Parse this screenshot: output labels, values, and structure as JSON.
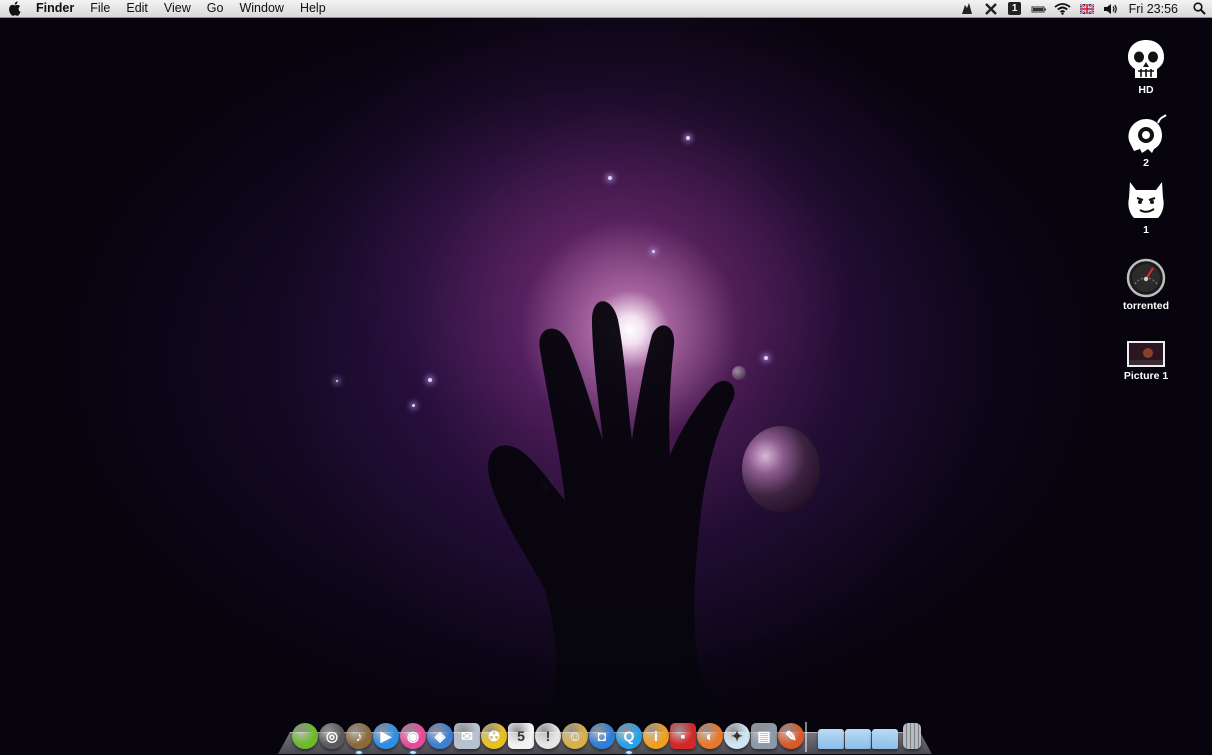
{
  "menubar": {
    "apple_icon": "apple-logo-icon",
    "items": [
      "Finder",
      "File",
      "Edit",
      "View",
      "Go",
      "Window",
      "Help"
    ],
    "status_icons": [
      "growl-icon",
      "tools-icon",
      "number-badge-icon",
      "battery-icon",
      "wifi-icon",
      "flag-uk-icon",
      "volume-icon"
    ],
    "status_badge_text": "1",
    "clock": "Fri 23:56",
    "spotlight_icon": "spotlight-search-icon"
  },
  "desktop": {
    "icons": [
      {
        "label": "HD",
        "icon": "skull-drive-icon"
      },
      {
        "label": "2",
        "icon": "monster-drive-icon"
      },
      {
        "label": "1",
        "icon": "cat-drive-icon"
      },
      {
        "label": "torrented",
        "icon": "gauge-drive-icon"
      },
      {
        "label": "Picture 1",
        "icon": "screenshot-file-icon"
      }
    ]
  },
  "dock": {
    "apps": [
      {
        "name": "apple-green-icon",
        "color": "#6dbb2a",
        "glyph": ""
      },
      {
        "name": "dashboard-icon",
        "color": "#5a5a5a",
        "glyph": "◎"
      },
      {
        "name": "garageband-guitar-icon",
        "color": "#8a6a3a",
        "glyph": "♪"
      },
      {
        "name": "media-player-icon",
        "color": "#2e8ee6",
        "glyph": "▶"
      },
      {
        "name": "itunes-pink-icon",
        "color": "#e64a9a",
        "glyph": "◉"
      },
      {
        "name": "browser-blue-icon",
        "color": "#3c7fd0",
        "glyph": "◈"
      },
      {
        "name": "mail-icon",
        "color": "#b8c2cf",
        "glyph": "✉"
      },
      {
        "name": "radiation-icon",
        "color": "#e8c020",
        "glyph": "☢"
      },
      {
        "name": "calendar-icon",
        "color": "#f2f2f2",
        "glyph": "5"
      },
      {
        "name": "chat-bubbles-icon",
        "color": "#e6e6e6",
        "glyph": "!"
      },
      {
        "name": "address-book-icon",
        "color": "#d8b04a",
        "glyph": "☺"
      },
      {
        "name": "camera-icon",
        "color": "#2f7fd6",
        "glyph": "◘"
      },
      {
        "name": "quicktime-icon",
        "color": "#2aa0e8",
        "glyph": "Q"
      },
      {
        "name": "info-orange-icon",
        "color": "#f0a020",
        "glyph": "i"
      },
      {
        "name": "red-chair-icon",
        "color": "#d42828",
        "glyph": "▪"
      },
      {
        "name": "firefox-icon",
        "color": "#e8782a",
        "glyph": "◐"
      },
      {
        "name": "safari-icon",
        "color": "#cfe6f5",
        "glyph": "✦"
      },
      {
        "name": "preview-icon",
        "color": "#8c99a8",
        "glyph": "▤"
      },
      {
        "name": "photo-tool-icon",
        "color": "#d85a2a",
        "glyph": "✎"
      }
    ],
    "folders": [
      {
        "name": "folder-icon",
        "color": "#8cbde8"
      },
      {
        "name": "folder-icon",
        "color": "#8cbde8"
      },
      {
        "name": "folder-icon",
        "color": "#8cbde8"
      }
    ],
    "trash": {
      "name": "trash-icon",
      "color": "#b7bcc2"
    },
    "running": [
      2,
      4,
      12
    ]
  }
}
